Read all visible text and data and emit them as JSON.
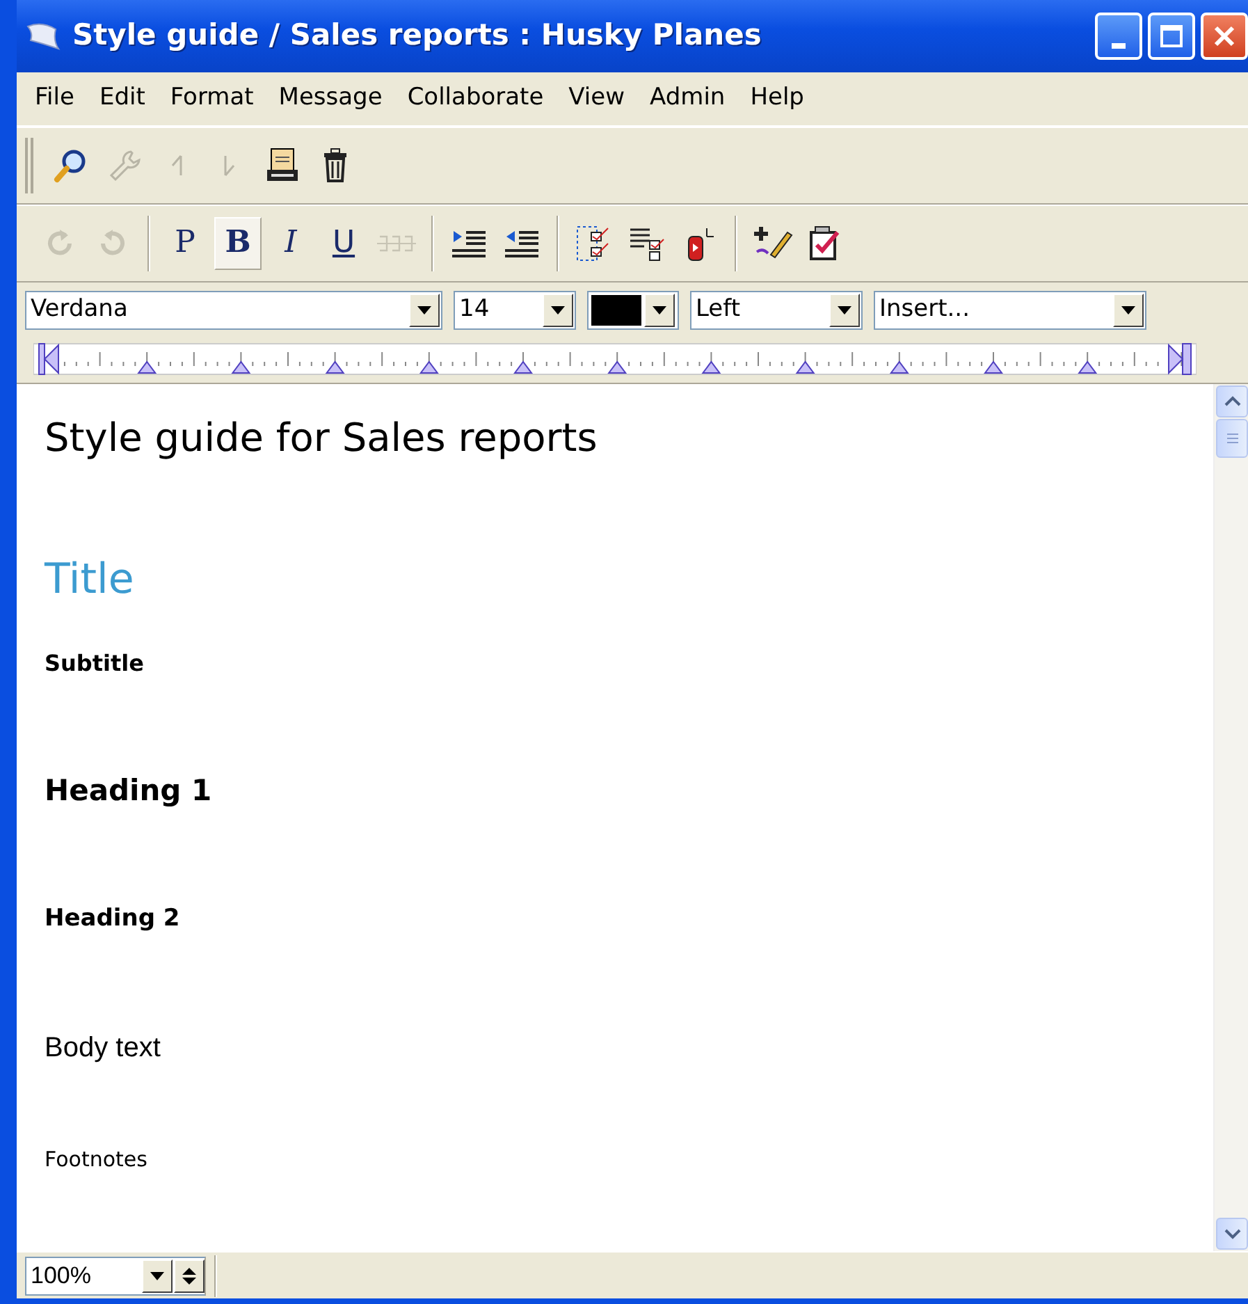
{
  "window": {
    "title": "Style guide / Sales reports : Husky Planes"
  },
  "menu": [
    "File",
    "Edit",
    "Format",
    "Message",
    "Collaborate",
    "View",
    "Admin",
    "Help"
  ],
  "toolbar": [
    {
      "disabled": false
    },
    {
      "disabled": true
    },
    {
      "disabled": true
    },
    {
      "disabled": true
    },
    {
      "disabled": false
    },
    {
      "disabled": false
    }
  ],
  "format_toolbar": [
    {
      "kind": "icon",
      "disabled": true
    },
    {
      "kind": "icon",
      "disabled": true
    },
    {
      "kind": "sep"
    },
    {
      "kind": "text",
      "label": "P",
      "disabled": false,
      "selected": false
    },
    {
      "kind": "text",
      "label": "B",
      "disabled": false,
      "selected": true
    },
    {
      "kind": "text",
      "label": "I",
      "disabled": false,
      "selected": false
    },
    {
      "kind": "text",
      "label": "U",
      "disabled": false,
      "selected": false
    },
    {
      "kind": "icon",
      "disabled": true
    },
    {
      "kind": "sep"
    },
    {
      "kind": "icon",
      "disabled": false
    },
    {
      "kind": "icon",
      "disabled": false
    },
    {
      "kind": "sep"
    },
    {
      "kind": "icon",
      "disabled": false
    },
    {
      "kind": "icon",
      "disabled": false
    },
    {
      "kind": "icon",
      "disabled": false
    },
    {
      "kind": "sep"
    },
    {
      "kind": "icon",
      "disabled": false
    },
    {
      "kind": "icon",
      "disabled": false
    }
  ],
  "format_bar": {
    "font": "Verdana",
    "size": "14",
    "align": "Left",
    "insert": "Insert..."
  },
  "document": [
    {
      "kind": "doc-title",
      "text": "Style guide for Sales reports"
    },
    {
      "kind": "title",
      "text": "Title"
    },
    {
      "kind": "subtitle",
      "text": "Subtitle"
    },
    {
      "kind": "heading1",
      "text": "Heading 1"
    },
    {
      "kind": "heading2",
      "text": "Heading 2"
    },
    {
      "kind": "body",
      "text": "Body text"
    },
    {
      "kind": "footnote",
      "text": "Footnotes"
    }
  ],
  "status_bar": {
    "zoom": "100%"
  }
}
